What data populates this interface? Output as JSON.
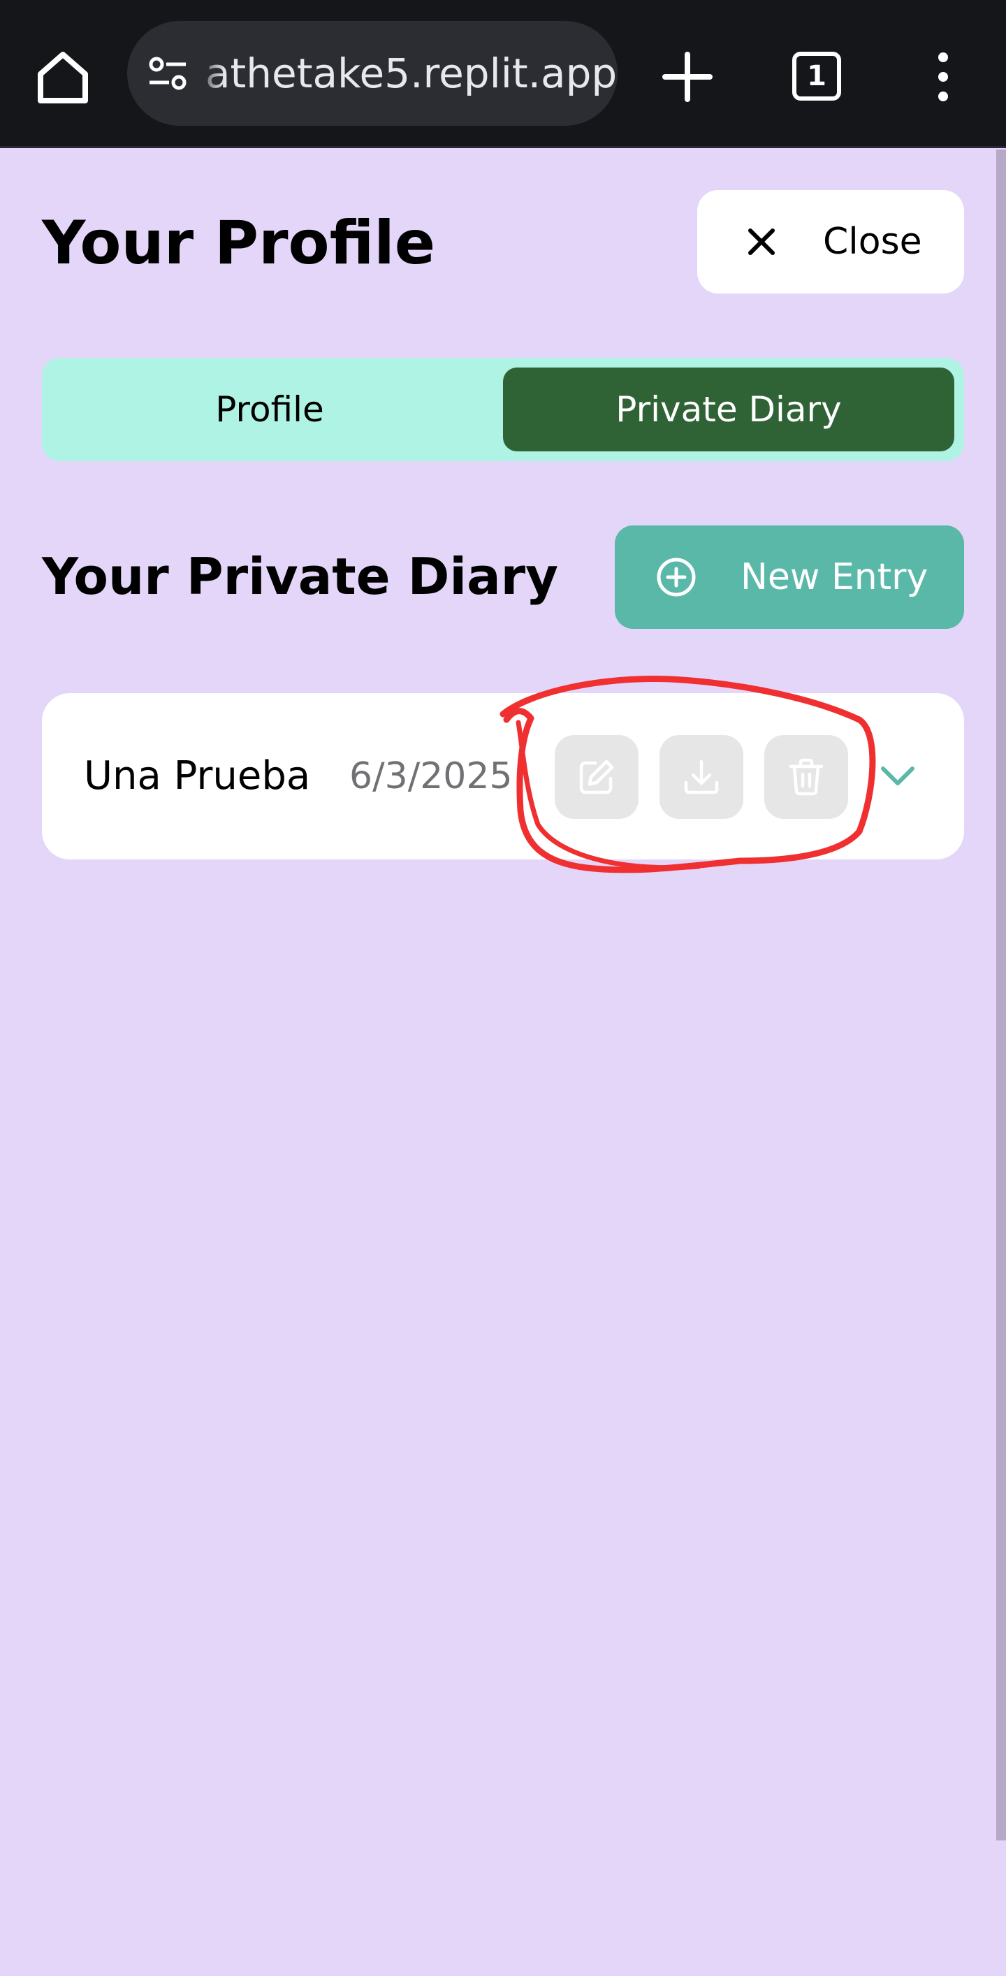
{
  "browser": {
    "url": "athetake5.replit.app",
    "tab_count": "1"
  },
  "header": {
    "title": "Your Profile",
    "close_label": "Close"
  },
  "tabs": [
    {
      "label": "Profile",
      "active": false
    },
    {
      "label": "Private Diary",
      "active": true
    }
  ],
  "diary": {
    "title": "Your Private Diary",
    "new_entry_label": "New Entry",
    "entries": [
      {
        "title": "Una Prueba",
        "date": "6/3/2025"
      }
    ]
  },
  "colors": {
    "background": "#e4d6f9",
    "tab_bar": "#aef3e3",
    "active_tab": "#2f6336",
    "new_entry": "#5ab8a8",
    "annotation": "#f03030"
  },
  "icons": {
    "home": "home-icon",
    "site_settings": "tune-icon",
    "new_tab": "plus-icon",
    "tabs": "tab-switcher-icon",
    "menu": "more-vert-icon",
    "close": "close-icon",
    "new_entry": "plus-circle-icon",
    "edit": "edit-icon",
    "download": "download-icon",
    "delete": "trash-icon",
    "expand": "chevron-down-icon"
  }
}
